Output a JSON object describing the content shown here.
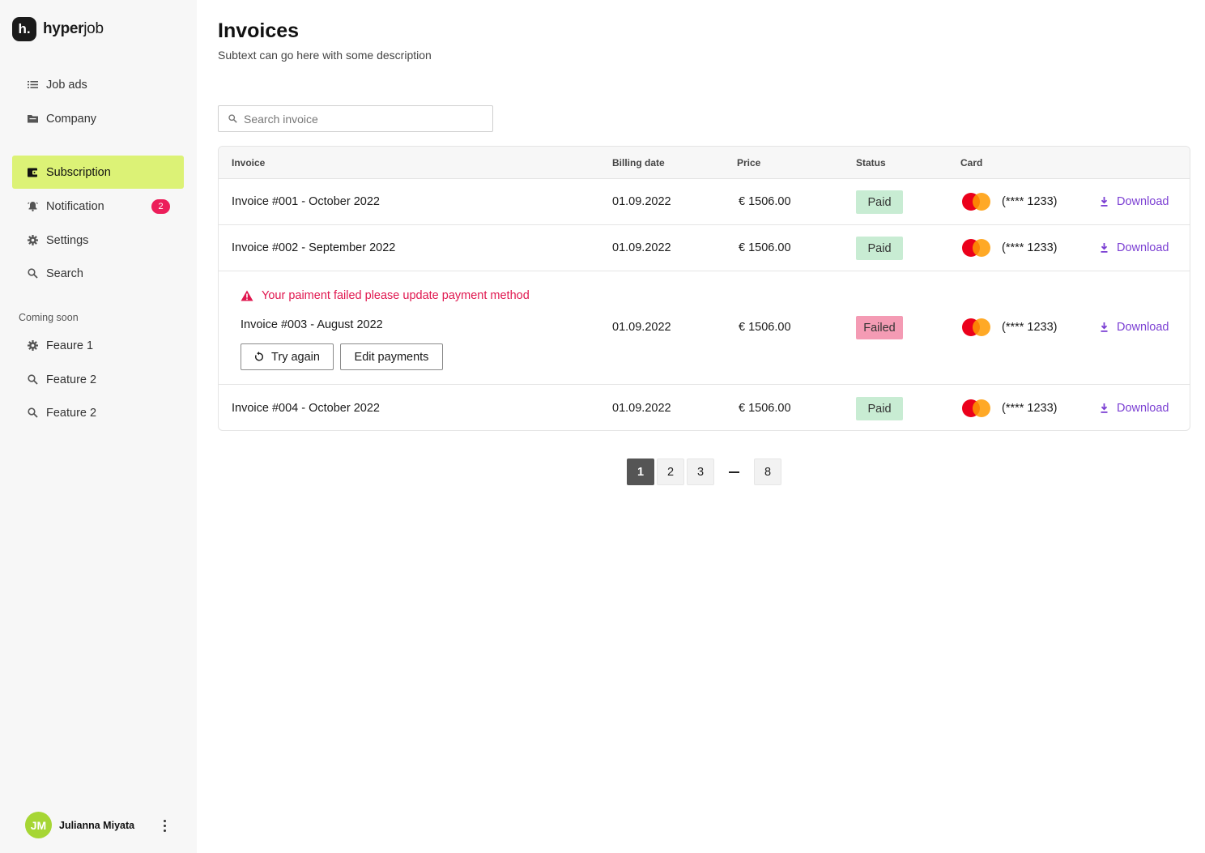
{
  "brand": {
    "mark": "h.",
    "name_bold": "hyper",
    "name_rest": "job"
  },
  "sidebar": {
    "items": [
      {
        "label": "Job ads",
        "icon": "list-icon"
      },
      {
        "label": "Company",
        "icon": "folder-icon"
      },
      {
        "label": "Subscription",
        "icon": "wallet-icon",
        "active": true
      },
      {
        "label": "Notification",
        "icon": "bell-icon",
        "badge": "2"
      },
      {
        "label": "Settings",
        "icon": "gear-icon"
      },
      {
        "label": "Search",
        "icon": "search-icon"
      }
    ],
    "section_label": "Coming soon",
    "soon_items": [
      {
        "label": "Feaure 1",
        "icon": "gear-icon"
      },
      {
        "label": "Feature 2",
        "icon": "search-icon"
      },
      {
        "label": "Feature 2",
        "icon": "search-icon"
      }
    ],
    "active_color": "#dcf276",
    "badge_color": "#ec1e5a"
  },
  "user": {
    "initials": "JM",
    "name": "Julianna Miyata",
    "avatar_color": "#a6d634"
  },
  "page": {
    "title": "Invoices",
    "subtitle": "Subtext can go here with some description"
  },
  "search": {
    "placeholder": "Search invoice",
    "value": ""
  },
  "table": {
    "headers": [
      "Invoice",
      "Billing date",
      "Price",
      "Status",
      "Card"
    ],
    "download_label": "Download",
    "rows": [
      {
        "invoice": "Invoice #001 - October 2022",
        "billing_date": "01.09.2022",
        "price": "€ 1506.00",
        "status": "Paid",
        "card": "(**** 1233)"
      },
      {
        "invoice": "Invoice #002 - September 2022",
        "billing_date": "01.09.2022",
        "price": "€ 1506.00",
        "status": "Paid",
        "card": "(**** 1233)"
      },
      {
        "invoice": "Invoice #003 - August 2022",
        "billing_date": "01.09.2022",
        "price": "€ 1506.00",
        "status": "Failed",
        "card": "(**** 1233)",
        "alert": "Your paiment failed please update payment method",
        "actions": {
          "retry": "Try again",
          "edit": "Edit payments"
        }
      },
      {
        "invoice": "Invoice #004 - October 2022",
        "billing_date": "01.09.2022",
        "price": "€ 1506.00",
        "status": "Paid",
        "card": "(**** 1233)"
      }
    ],
    "status_colors": {
      "paid": "#c8ecd3",
      "failed": "#f49bb4"
    },
    "link_color": "#7b3fd3",
    "alert_color": "#e0174f"
  },
  "pagination": {
    "pages": [
      "1",
      "2",
      "3"
    ],
    "last": "8",
    "current": "1"
  }
}
